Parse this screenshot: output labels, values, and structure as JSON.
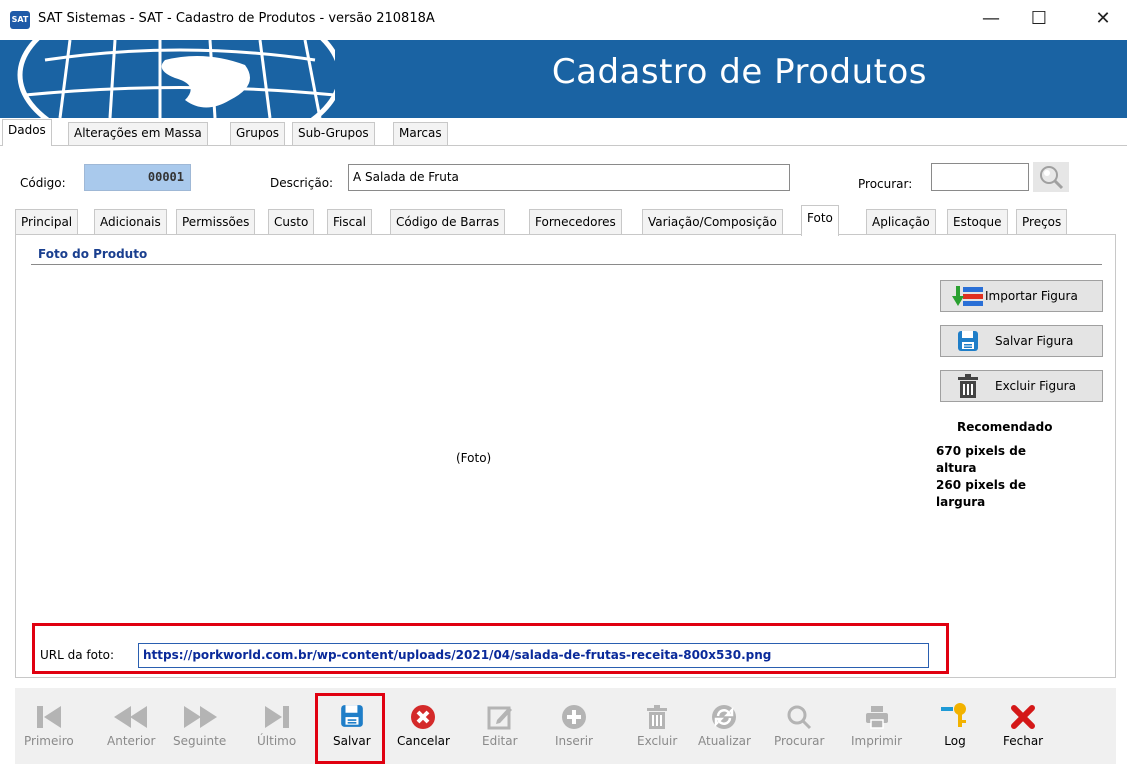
{
  "window": {
    "icon_text": "SAT",
    "title": "SAT Sistemas - SAT - Cadastro de Produtos - versão 210818A",
    "minimize": "—",
    "maximize": "☐",
    "close": "✕"
  },
  "banner": {
    "title": "Cadastro de Produtos"
  },
  "main_tabs": [
    {
      "label": "Dados",
      "active": true
    },
    {
      "label": "Alterações em Massa",
      "active": false
    },
    {
      "label": "Grupos",
      "active": false
    },
    {
      "label": "Sub-Grupos",
      "active": false
    },
    {
      "label": "Marcas",
      "active": false
    }
  ],
  "record": {
    "codigo_label": "Código:",
    "codigo_value": "00001",
    "descricao_label": "Descrição:",
    "descricao_value": "A Salada de Fruta",
    "procurar_label": "Procurar:",
    "procurar_value": ""
  },
  "sub_tabs": [
    {
      "label": "Principal",
      "active": false
    },
    {
      "label": "Adicionais",
      "active": false
    },
    {
      "label": "Permissões",
      "active": false
    },
    {
      "label": "Custo",
      "active": false
    },
    {
      "label": "Fiscal",
      "active": false
    },
    {
      "label": "Código de Barras",
      "active": false
    },
    {
      "label": "Fornecedores",
      "active": false
    },
    {
      "label": "Variação/Composição",
      "active": false
    },
    {
      "label": "Foto",
      "active": true
    },
    {
      "label": "Aplicação",
      "active": false
    },
    {
      "label": "Estoque",
      "active": false
    },
    {
      "label": "Preços",
      "active": false
    }
  ],
  "foto": {
    "section_title": "Foto do Produto",
    "placeholder": "(Foto)",
    "buttons": {
      "importar": "Importar Figura",
      "salvar": "Salvar Figura",
      "excluir": "Excluir Figura"
    },
    "recomendado_title": "Recomendado",
    "recomendado_line1": "670 pixels de",
    "recomendado_line2": "altura",
    "recomendado_line3": "260 pixels de",
    "recomendado_line4": "largura",
    "url_label": "URL da foto:",
    "url_value": "https://porkworld.com.br/wp-content/uploads/2021/04/salada-de-frutas-receita-800x530.png"
  },
  "toolbar": {
    "primeiro": "Primeiro",
    "anterior": "Anterior",
    "seguinte": "Seguinte",
    "ultimo": "Último",
    "salvar": "Salvar",
    "cancelar": "Cancelar",
    "editar": "Editar",
    "inserir": "Inserir",
    "excluir": "Excluir",
    "atualizar": "Atualizar",
    "procurar": "Procurar",
    "imprimir": "Imprimir",
    "log": "Log",
    "fechar": "Fechar"
  },
  "colors": {
    "banner": "#1a63a3",
    "highlight_frame": "#e00010",
    "url_text": "#0a2a9a",
    "disabled_icon": "#b4b4b4"
  }
}
